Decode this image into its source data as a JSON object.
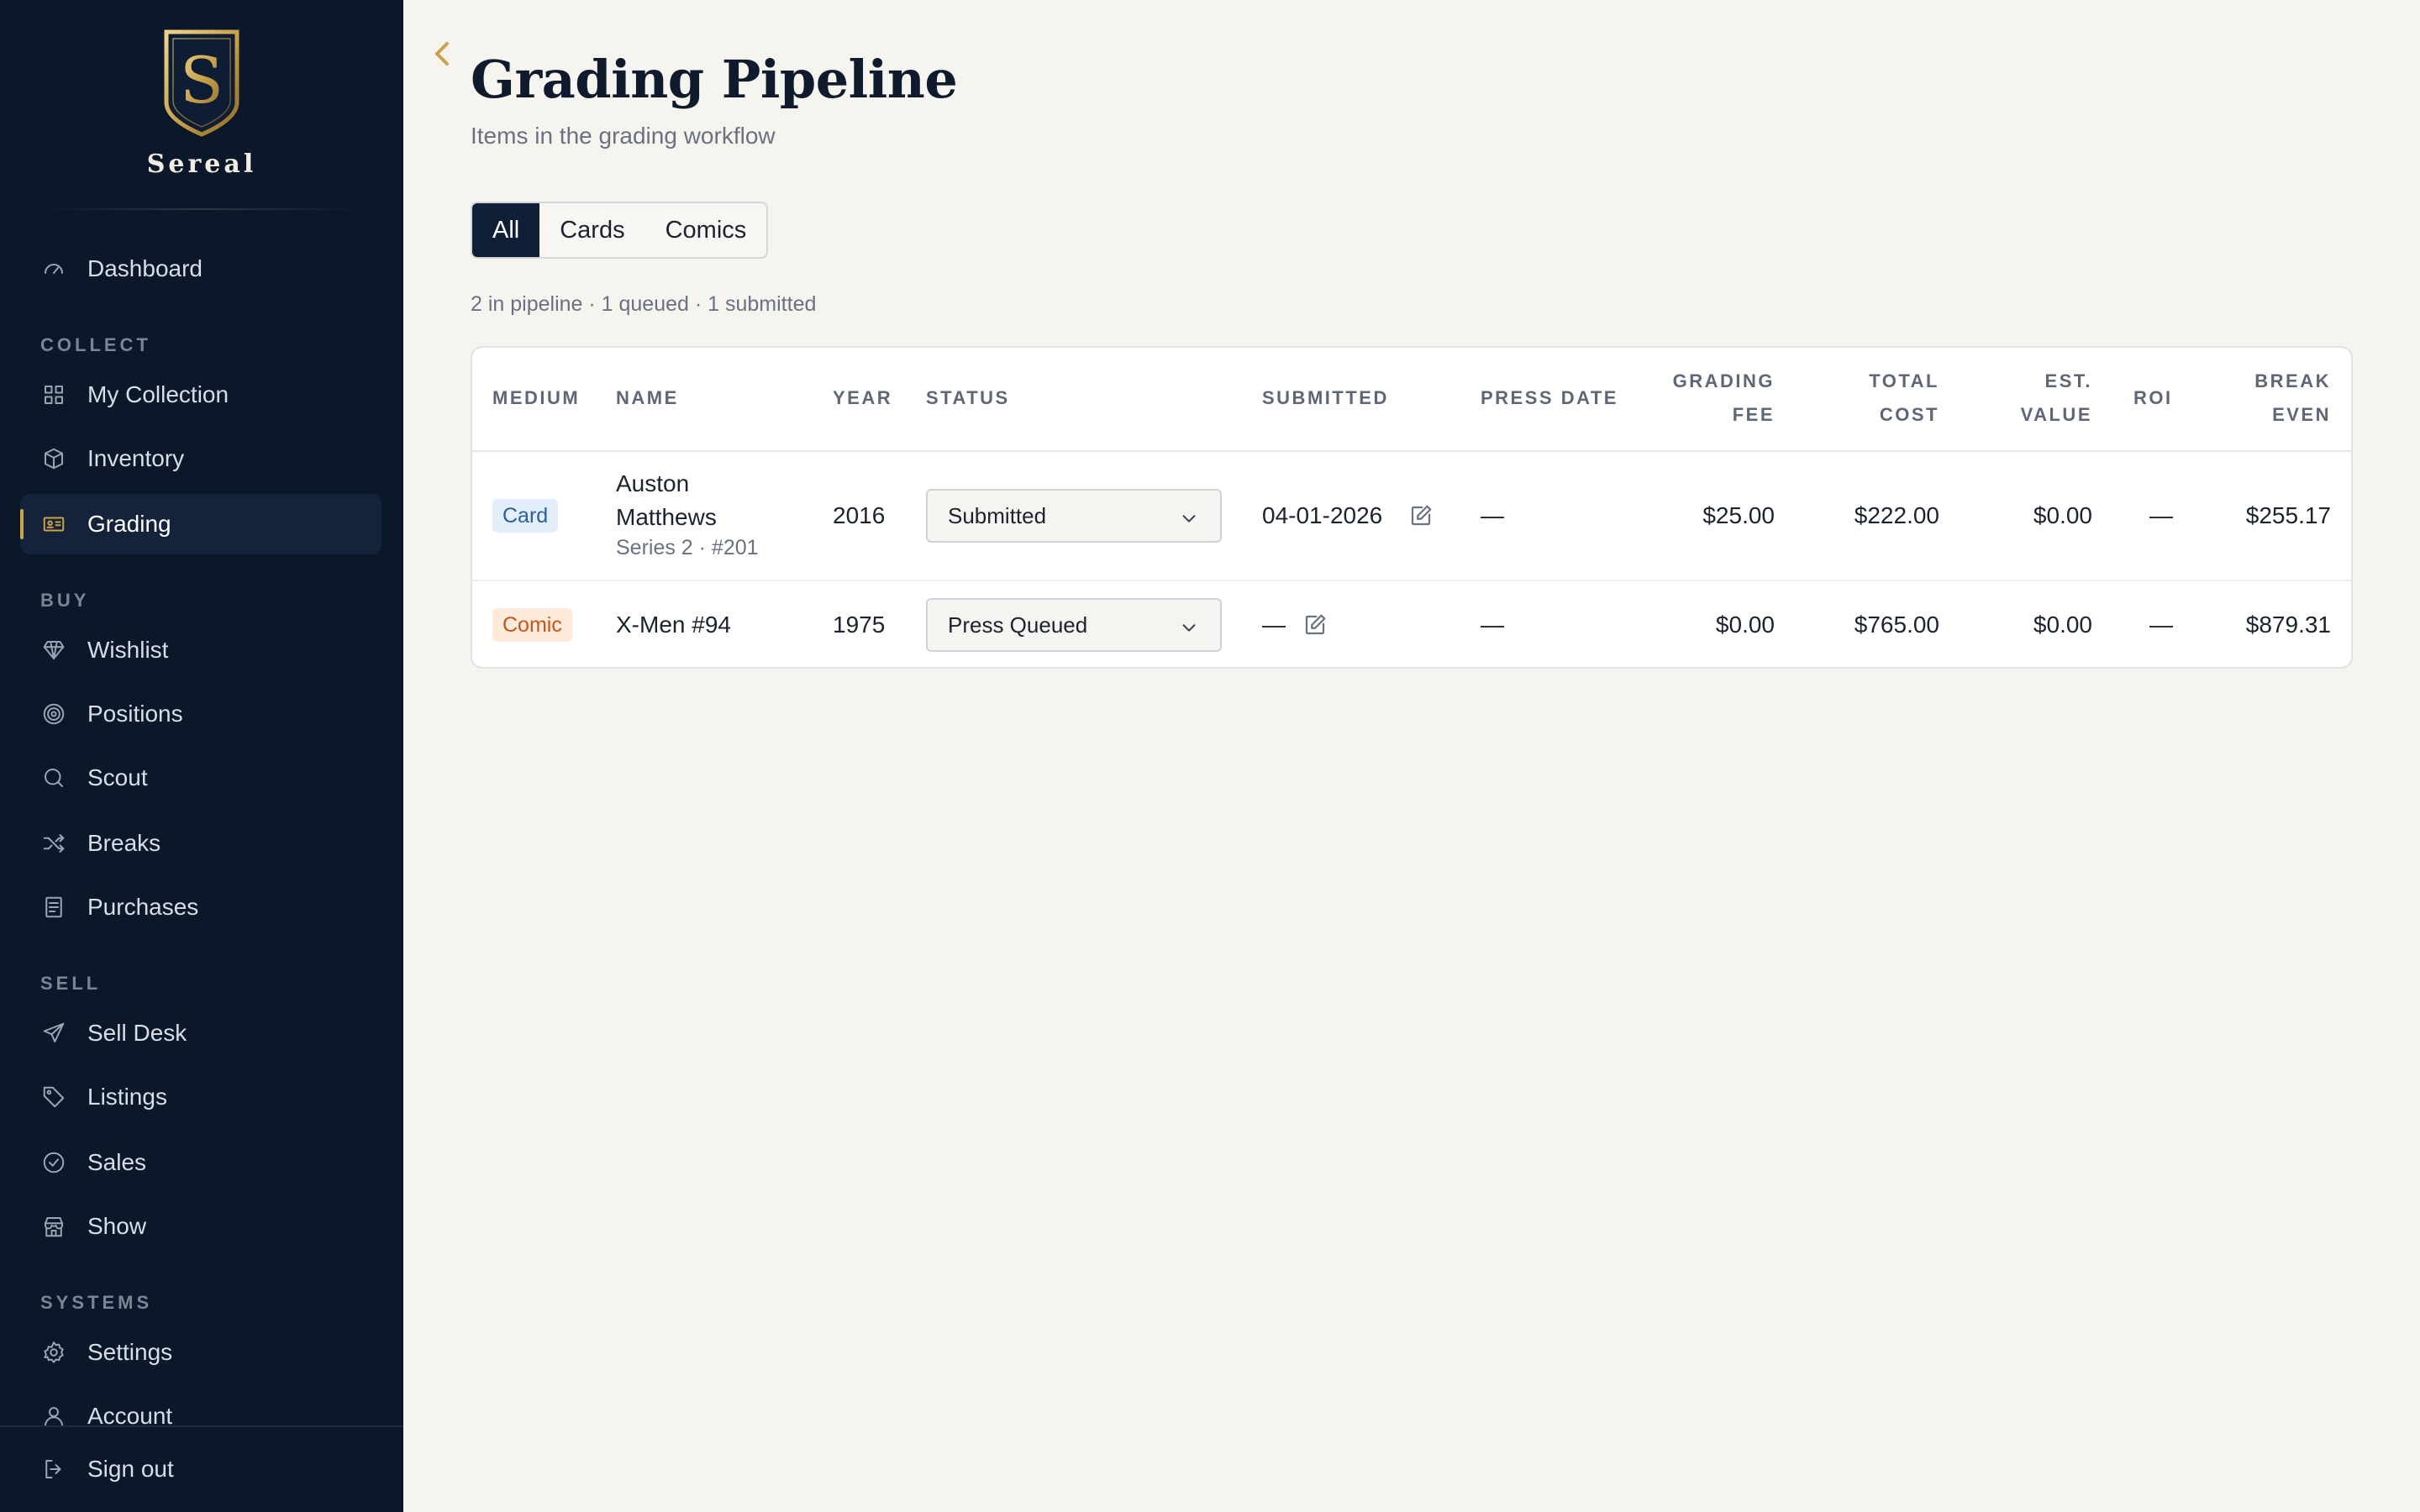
{
  "brand": {
    "name": "Sereal",
    "logo_letter": "S"
  },
  "sidebar": {
    "sections": {
      "collect": "COLLECT",
      "buy": "BUY",
      "sell": "SELL",
      "systems": "SYSTEMS"
    },
    "items": {
      "dashboard": "Dashboard",
      "my_collection": "My Collection",
      "inventory": "Inventory",
      "grading": "Grading",
      "wishlist": "Wishlist",
      "positions": "Positions",
      "scout": "Scout",
      "breaks": "Breaks",
      "purchases": "Purchases",
      "sell_desk": "Sell Desk",
      "listings": "Listings",
      "sales": "Sales",
      "show": "Show",
      "settings": "Settings",
      "account": "Account",
      "sign_out": "Sign out"
    },
    "active": "grading"
  },
  "page": {
    "title": "Grading Pipeline",
    "subtitle": "Items in the grading workflow",
    "filters": [
      "All",
      "Cards",
      "Comics"
    ],
    "active_filter": "All",
    "summary": "2 in pipeline · 1 queued · 1 submitted"
  },
  "table": {
    "headers": {
      "medium": "MEDIUM",
      "name": "NAME",
      "year": "YEAR",
      "status": "STATUS",
      "submitted": "SUBMITTED",
      "press_date": "PRESS DATE",
      "grading_fee_1": "GRADING",
      "grading_fee_2": "FEE",
      "total_cost_1": "TOTAL",
      "total_cost_2": "COST",
      "est_value_1": "EST.",
      "est_value_2": "VALUE",
      "roi": "ROI",
      "break_even_1": "BREAK",
      "break_even_2": "EVEN"
    },
    "rows": [
      {
        "medium": "Card",
        "name_line1": "Auston",
        "name_line2": "Matthews",
        "detail": "Series 2 · #201",
        "year": "2016",
        "status": "Submitted",
        "submitted": "04-01-2026",
        "press_date": "—",
        "grading_fee": "$25.00",
        "total_cost": "$222.00",
        "est_value": "$0.00",
        "roi": "—",
        "break_even": "$255.17"
      },
      {
        "medium": "Comic",
        "name": "X-Men #94",
        "year": "1975",
        "status": "Press Queued",
        "submitted": "—",
        "press_date": "—",
        "grading_fee": "$0.00",
        "total_cost": "$765.00",
        "est_value": "$0.00",
        "roi": "—",
        "break_even": "$879.31"
      }
    ]
  },
  "colors": {
    "sidebar_bg": "#0b1829",
    "accent_gold": "#c9a24a",
    "active_filter_bg": "#0f1f38",
    "page_bg": "#f5f4ef"
  },
  "icons": [
    "shield-logo-icon",
    "gauge-icon",
    "grid-icon",
    "box-icon",
    "id-card-icon",
    "gem-icon",
    "target-icon",
    "search-icon",
    "shuffle-icon",
    "receipt-icon",
    "send-icon",
    "tag-icon",
    "check-circle-icon",
    "store-icon",
    "gear-icon",
    "user-icon",
    "logout-icon",
    "chevron-left-icon",
    "chevron-down-icon",
    "edit-icon"
  ]
}
